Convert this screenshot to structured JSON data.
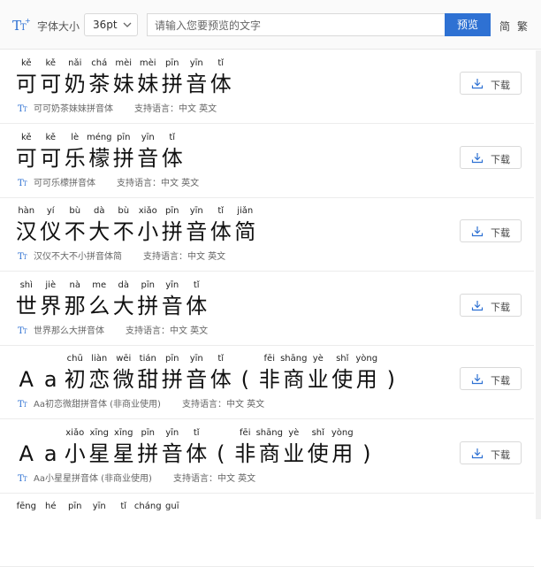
{
  "toolbar": {
    "size_label": "字体大小",
    "size_value": "36pt",
    "search_placeholder": "请输入您要预览的文字",
    "preview_label": "预览",
    "simplified_label": "简",
    "traditional_label": "繁"
  },
  "fonts": [
    {
      "pinyin": [
        "kě",
        "kě",
        "nǎi",
        "chá",
        "mèi",
        "mèi",
        "pīn",
        "yīn",
        "tǐ"
      ],
      "chars": [
        "可",
        "可",
        "奶",
        "茶",
        "妹",
        "妹",
        "拼",
        "音",
        "体"
      ],
      "name": "可可奶茶妹妹拼音体",
      "support": "支持语言：中文 英文",
      "download": "下载"
    },
    {
      "pinyin": [
        "kě",
        "kě",
        "lè",
        "méng",
        "pīn",
        "yīn",
        "tǐ"
      ],
      "chars": [
        "可",
        "可",
        "乐",
        "檬",
        "拼",
        "音",
        "体"
      ],
      "name": "可可乐檬拼音体",
      "support": "支持语言：中文 英文",
      "download": "下载"
    },
    {
      "pinyin": [
        "hàn",
        "yí",
        "bù",
        "dà",
        "bù",
        "xiǎo",
        "pīn",
        "yīn",
        "tǐ",
        "jiǎn"
      ],
      "chars": [
        "汉",
        "仪",
        "不",
        "大",
        "不",
        "小",
        "拼",
        "音",
        "体",
        "简"
      ],
      "name": "汉仪不大不小拼音体简",
      "support": "支持语言：中文 英文",
      "download": "下载"
    },
    {
      "pinyin": [
        "shì",
        "jiè",
        "nà",
        "me",
        "dà",
        "pīn",
        "yīn",
        "tǐ"
      ],
      "chars": [
        "世",
        "界",
        "那",
        "么",
        "大",
        "拼",
        "音",
        "体"
      ],
      "name": "世界那么大拼音体",
      "support": "支持语言：中文 英文",
      "download": "下载"
    },
    {
      "pinyin": [
        "",
        "",
        "chū",
        "liàn",
        "wēi",
        "tián",
        "pīn",
        "yīn",
        "tǐ",
        "",
        "fēi",
        "shāng",
        "yè",
        "shǐ",
        "yòng",
        ""
      ],
      "chars": [
        "A",
        "a",
        "初",
        "恋",
        "微",
        "甜",
        "拼",
        "音",
        "体",
        "(",
        "非",
        "商",
        "业",
        "使",
        "用",
        ")"
      ],
      "name": "Aa初恋微甜拼音体 (非商业使用)",
      "support": "支持语言：中文 英文",
      "download": "下载"
    },
    {
      "pinyin": [
        "",
        "",
        "xiǎo",
        "xīng",
        "xīng",
        "pīn",
        "yīn",
        "tǐ",
        "",
        "fēi",
        "shāng",
        "yè",
        "shǐ",
        "yòng",
        ""
      ],
      "chars": [
        "A",
        "a",
        "小",
        "星",
        "星",
        "拼",
        "音",
        "体",
        "(",
        "非",
        "商",
        "业",
        "使",
        "用",
        ")"
      ],
      "name": "Aa小星星拼音体 (非商业使用)",
      "support": "支持语言：中文 英文",
      "download": "下载"
    },
    {
      "pinyin": [
        "fēng",
        "hé",
        "pīn",
        "yīn",
        "tǐ",
        "cháng",
        "guī"
      ],
      "chars": [
        "",
        "",
        "",
        "",
        "",
        "",
        ""
      ],
      "name": "",
      "support": "",
      "download": ""
    }
  ]
}
